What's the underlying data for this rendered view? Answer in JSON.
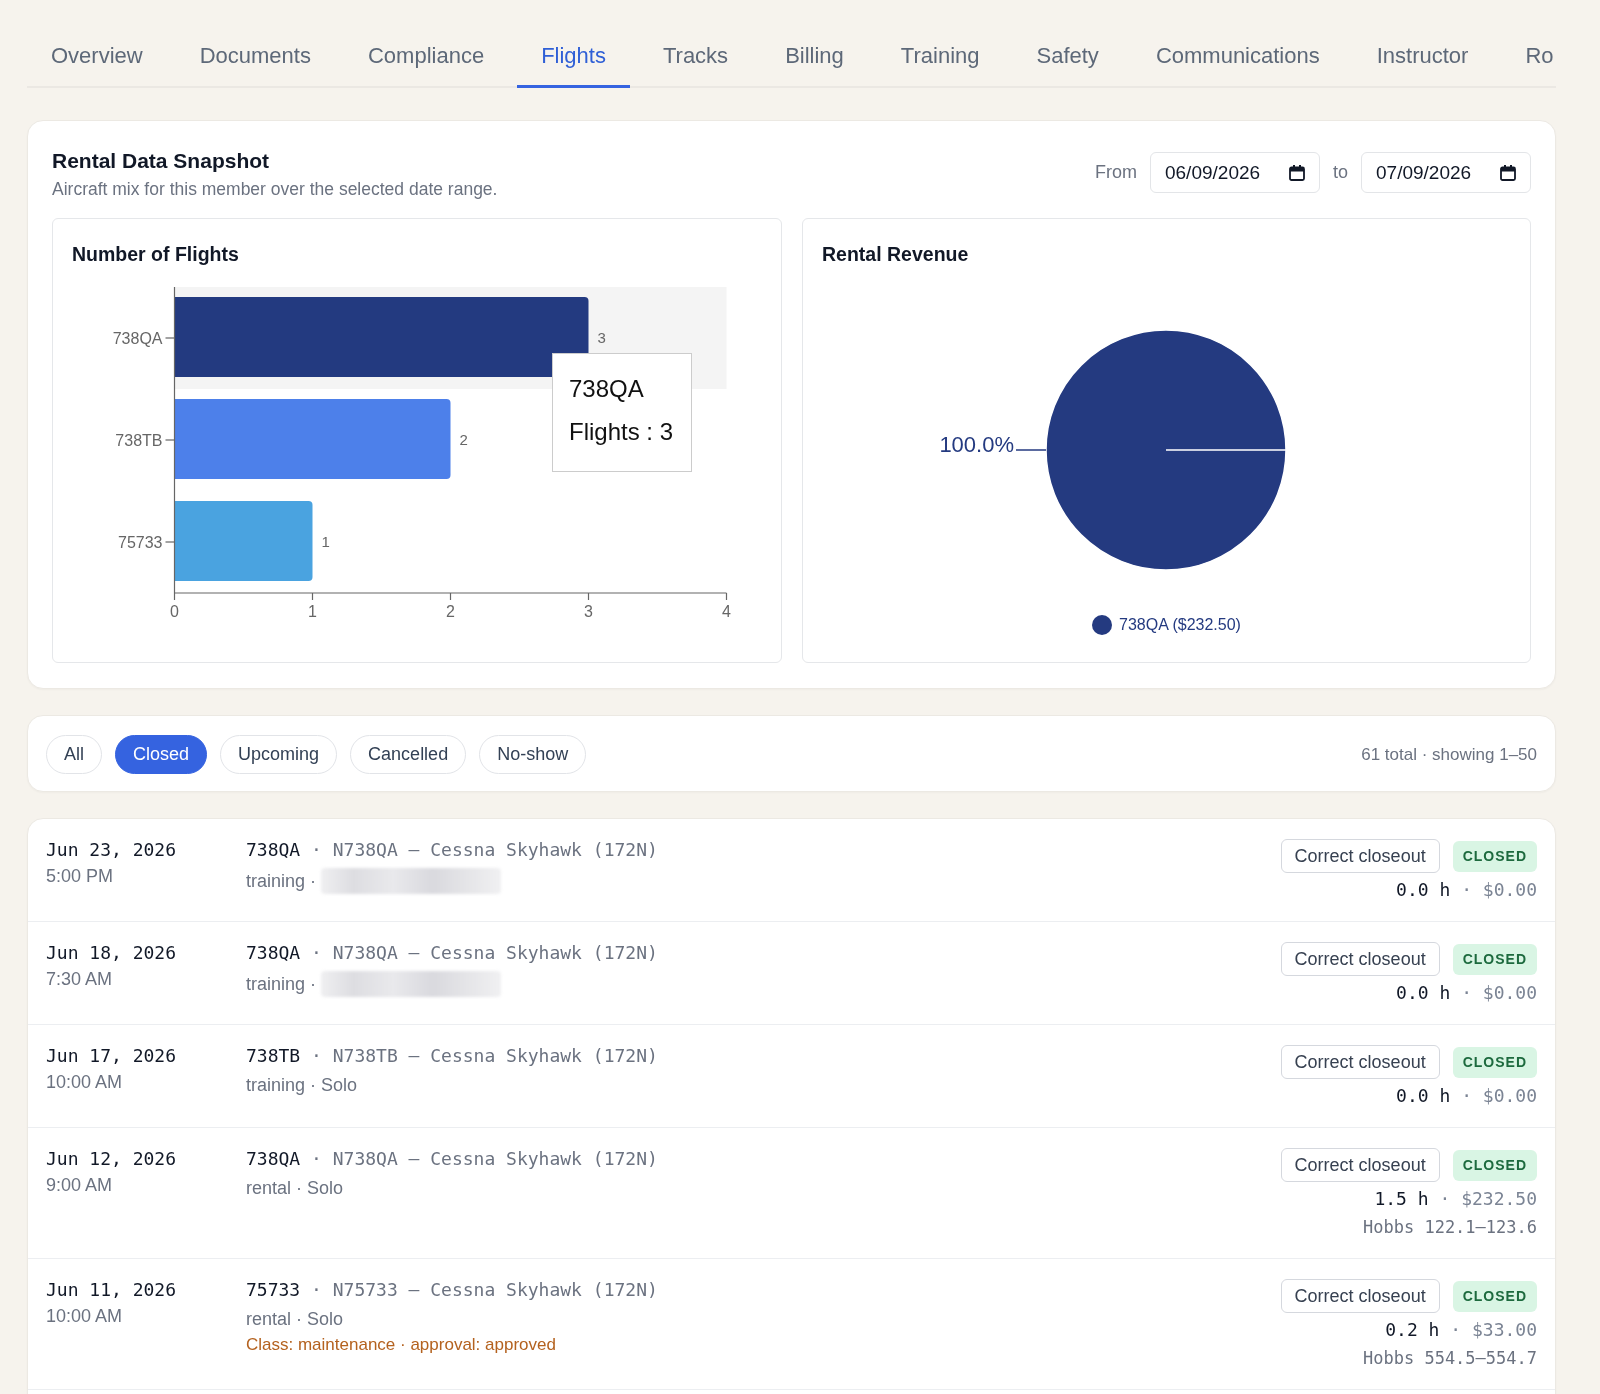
{
  "tabs": [
    {
      "label": "Overview",
      "selected": false
    },
    {
      "label": "Documents",
      "selected": false
    },
    {
      "label": "Compliance",
      "selected": false
    },
    {
      "label": "Flights",
      "selected": true
    },
    {
      "label": "Tracks",
      "selected": false
    },
    {
      "label": "Billing",
      "selected": false
    },
    {
      "label": "Training",
      "selected": false
    },
    {
      "label": "Safety",
      "selected": false
    },
    {
      "label": "Communications",
      "selected": false
    },
    {
      "label": "Instructor",
      "selected": false
    },
    {
      "label": "Ro",
      "selected": false
    }
  ],
  "snapshot": {
    "title": "Rental Data Snapshot",
    "subtitle": "Aircraft mix for this member over the selected date range.",
    "date_range": {
      "from_label": "From",
      "from": "06/09/2026",
      "to_label": "to",
      "to": "07/09/2026"
    },
    "flights_chart": {
      "chart_data": {
        "type": "bar",
        "title": "Number of Flights",
        "orientation": "horizontal",
        "categories": [
          "738QA",
          "738TB",
          "75733"
        ],
        "values": [
          3,
          2,
          1
        ],
        "colors": [
          "#233a80",
          "#4d80ea",
          "#4aa3e0"
        ],
        "xlim": [
          0,
          4
        ],
        "xticks": [
          0,
          1,
          2,
          3,
          4
        ],
        "data_labels": true,
        "bands": [
          {
            "axis": "y",
            "from": "738QA",
            "to": "738QA",
            "color": "#f4f4f4"
          }
        ]
      },
      "tooltip": {
        "title": "738QA",
        "text": "Flights : 3"
      }
    },
    "revenue_chart": {
      "chart_data": {
        "type": "pie",
        "title": "Rental Revenue",
        "categories": [
          "738QA ($232.50)"
        ],
        "values": [
          100
        ],
        "colors": [
          "#243a80"
        ],
        "value_labels": [
          "100.0%"
        ]
      }
    }
  },
  "filters": {
    "chips": [
      {
        "label": "All",
        "selected": false
      },
      {
        "label": "Closed",
        "selected": true
      },
      {
        "label": "Upcoming",
        "selected": false
      },
      {
        "label": "Cancelled",
        "selected": false
      },
      {
        "label": "No-show",
        "selected": false
      }
    ],
    "summary": "61 total · showing 1–50"
  },
  "flights": [
    {
      "date": "Jun 23, 2026",
      "time": "5:00 PM",
      "tail": "738QA",
      "aircraft": "· N738QA – Cessna Skyhawk (172N)",
      "details": "training ·",
      "blurred": true,
      "action": "Correct closeout",
      "status": "CLOSED",
      "hours": "0.0 h",
      "cost": "· $0.00"
    },
    {
      "date": "Jun 18, 2026",
      "time": "7:30 AM",
      "tail": "738QA",
      "aircraft": "· N738QA – Cessna Skyhawk (172N)",
      "details": "training ·",
      "blurred": true,
      "action": "Correct closeout",
      "status": "CLOSED",
      "hours": "0.0 h",
      "cost": "· $0.00"
    },
    {
      "date": "Jun 17, 2026",
      "time": "10:00 AM",
      "tail": "738TB",
      "aircraft": "· N738TB – Cessna Skyhawk (172N)",
      "details": "training · Solo",
      "blurred": false,
      "action": "Correct closeout",
      "status": "CLOSED",
      "hours": "0.0 h",
      "cost": "· $0.00"
    },
    {
      "date": "Jun 12, 2026",
      "time": "9:00 AM",
      "tail": "738QA",
      "aircraft": "· N738QA – Cessna Skyhawk (172N)",
      "details": "rental · Solo",
      "blurred": false,
      "action": "Correct closeout",
      "status": "CLOSED",
      "hours": "1.5 h",
      "cost": "· $232.50",
      "hobbs": "Hobbs 122.1–123.6"
    },
    {
      "date": "Jun 11, 2026",
      "time": "10:00 AM",
      "tail": "75733",
      "aircraft": "· N75733 – Cessna Skyhawk (172N)",
      "details": "rental · Solo",
      "note": "Class: maintenance · approval: approved",
      "blurred": false,
      "action": "Correct closeout",
      "status": "CLOSED",
      "hours": "0.2 h",
      "cost": "· $33.00",
      "hobbs": "Hobbs 554.5–554.7"
    }
  ]
}
